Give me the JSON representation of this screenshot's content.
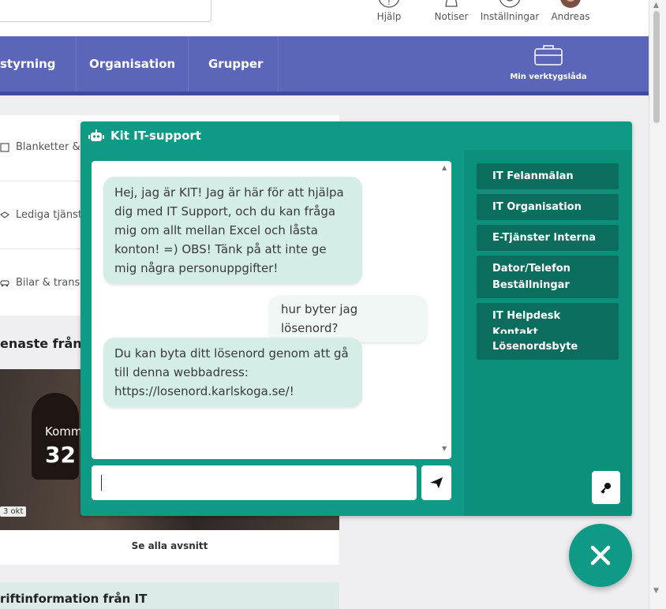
{
  "header": {
    "search_placeholder": "",
    "icons": [
      {
        "name": "help-icon",
        "label": "Hjälp"
      },
      {
        "name": "bell-icon",
        "label": "Notiser"
      },
      {
        "name": "settings-icon",
        "label": "Inställningar"
      },
      {
        "name": "avatar",
        "label": "Andreas"
      }
    ]
  },
  "nav": {
    "items": [
      "styrning",
      "Organisation",
      "Grupper"
    ],
    "toolbox_label": "Min verktygslåda"
  },
  "background": {
    "quicklinks": [
      "Blanketter &",
      "Lediga tjänst",
      "Bilar & trans"
    ],
    "news_title": "enaste från I",
    "news_overlay_title": "Komm",
    "news_overlay_number": "32",
    "date_badge": "3 okt",
    "see_all": "Se alla avsnitt",
    "drift_title": "riftinformation från IT"
  },
  "chat": {
    "title": "Kit IT-support",
    "messages": [
      {
        "from": "bot",
        "text": "Hej, jag är KIT! Jag är här för att hjälpa dig med IT Support, och du kan fråga mig om allt mellan Excel och låsta konton! =) OBS! Tänk på att inte ge mig några personuppgifter!"
      },
      {
        "from": "user",
        "text": "hur byter jag lösenord?"
      },
      {
        "from": "bot",
        "text": "Du kan byta ditt lösenord genom att gå till denna webbadress: https://losenord.karlskoga.se/!"
      }
    ],
    "input_value": "",
    "quick_buttons": [
      "IT Felanmälan",
      "IT Organisation",
      "E-Tjänster Interna",
      "Dator/Telefon Beställningar",
      "IT Helpdesk Kontakt",
      "Lösenordsbyte"
    ]
  },
  "colors": {
    "nav": "#5b66b8",
    "chat_accent": "#0e9a84",
    "chat_button": "#0b6d5e",
    "bot_bubble": "#d4ede7"
  }
}
